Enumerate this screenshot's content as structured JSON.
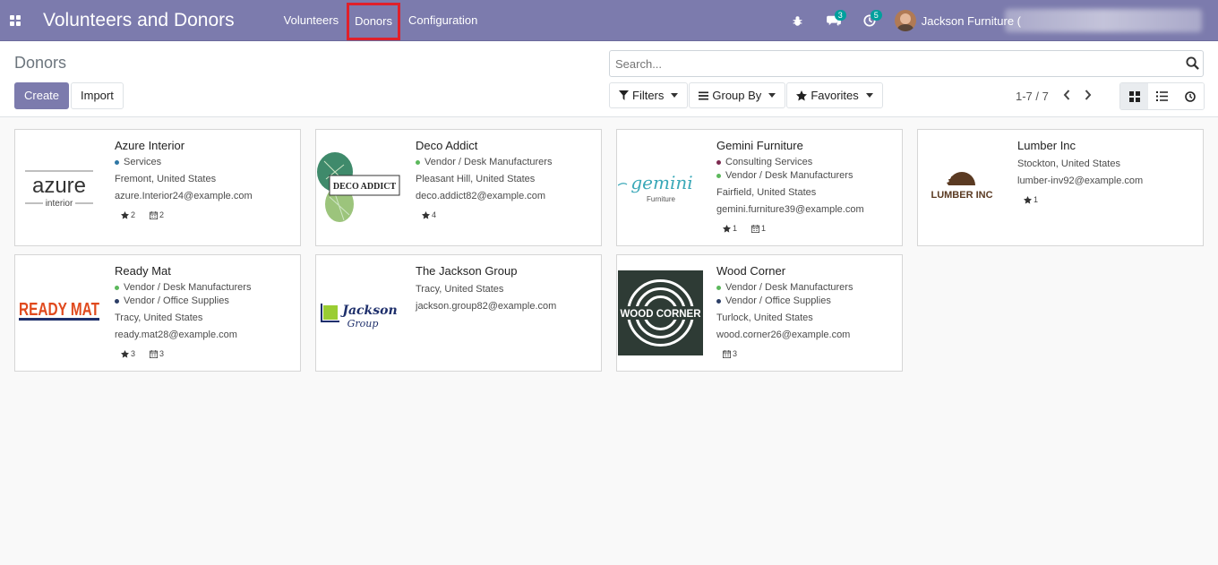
{
  "app": {
    "title": "Volunteers and Donors"
  },
  "menu": {
    "volunteers": "Volunteers",
    "donors": "Donors",
    "configuration": "Configuration"
  },
  "systray": {
    "messages_count": "3",
    "activities_count": "5",
    "user_name": "Jackson Furniture ("
  },
  "page": {
    "title": "Donors",
    "create_label": "Create",
    "import_label": "Import"
  },
  "search": {
    "placeholder": "Search..."
  },
  "filters": {
    "filters_label": "Filters",
    "groupby_label": "Group By",
    "favorites_label": "Favorites"
  },
  "pager": {
    "value": "1-7 / 7"
  },
  "cards": [
    {
      "name": "Azure Interior",
      "tags": [
        {
          "label": "Services",
          "color": "#2f77a5"
        }
      ],
      "city": "Fremont, United States",
      "email": "azure.Interior24@example.com",
      "stars": "2",
      "events": "2",
      "logo": "azure"
    },
    {
      "name": "Deco Addict",
      "tags": [
        {
          "label": "Vendor / Desk Manufacturers",
          "color": "#5cb85c"
        }
      ],
      "city": "Pleasant Hill, United States",
      "email": "deco.addict82@example.com",
      "stars": "4",
      "events": "",
      "logo": "deco"
    },
    {
      "name": "Gemini Furniture",
      "tags": [
        {
          "label": "Consulting Services",
          "color": "#7d2a4f"
        },
        {
          "label": "Vendor / Desk Manufacturers",
          "color": "#5cb85c"
        }
      ],
      "city": "Fairfield, United States",
      "email": "gemini.furniture39@example.com",
      "stars": "1",
      "events": "1",
      "logo": "gemini"
    },
    {
      "name": "Lumber Inc",
      "tags": [],
      "city": "Stockton, United States",
      "email": "lumber-inv92@example.com",
      "stars": "1",
      "events": "",
      "logo": "lumber"
    },
    {
      "name": "Ready Mat",
      "tags": [
        {
          "label": "Vendor / Desk Manufacturers",
          "color": "#5cb85c"
        },
        {
          "label": "Vendor / Office Supplies",
          "color": "#2c3e66"
        }
      ],
      "city": "Tracy, United States",
      "email": "ready.mat28@example.com",
      "stars": "3",
      "events": "3",
      "logo": "ready"
    },
    {
      "name": "The Jackson Group",
      "tags": [],
      "city": "Tracy, United States",
      "email": "jackson.group82@example.com",
      "stars": "",
      "events": "",
      "logo": "jackson"
    },
    {
      "name": "Wood Corner",
      "tags": [
        {
          "label": "Vendor / Desk Manufacturers",
          "color": "#5cb85c"
        },
        {
          "label": "Vendor / Office Supplies",
          "color": "#2c3e66"
        }
      ],
      "city": "Turlock, United States",
      "email": "wood.corner26@example.com",
      "stars": "",
      "events": "3",
      "logo": "wood"
    }
  ],
  "logos": {
    "azure_main": "azure",
    "azure_sub": "interior",
    "deco": "DECO ADDICT",
    "gemini_main": "gemini",
    "gemini_sub": "Furniture",
    "lumber": "LUMBER INC",
    "ready": "READY MAT",
    "jackson_main": "Jackson",
    "jackson_sub": "Group",
    "wood": "WOOD CORNER"
  },
  "colors": {
    "brand": "#7c7bad",
    "highlight": "#e0202a",
    "badge": "#00a09d"
  }
}
